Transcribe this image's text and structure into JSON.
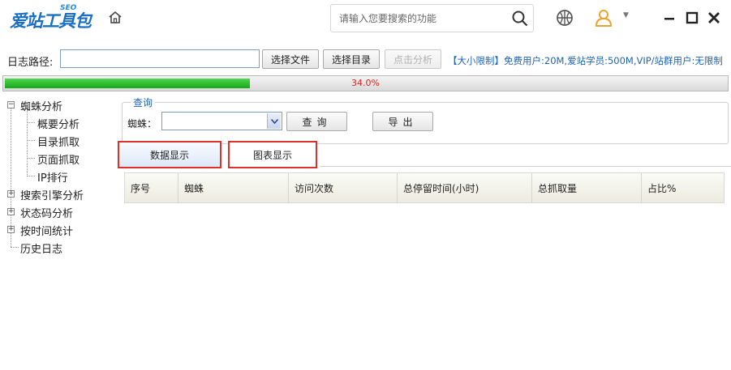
{
  "app": {
    "logo_text": "爱站工具包",
    "logo_badge": "SEO"
  },
  "search": {
    "placeholder": "请输入您要搜索的功能"
  },
  "toolbar": {
    "path_label": "日志路径:",
    "path_value": "",
    "choose_file": "选择文件",
    "choose_dir": "选择目录",
    "analyze": "点击分析",
    "size_note": "【大小限制】免费用户:20M,爱站学员:500M,VIP/站群用户:无限制"
  },
  "progress": {
    "value": 0.34,
    "label": "34.0%"
  },
  "sidebar": {
    "items": [
      {
        "label": "蜘蛛分析",
        "expandable": true,
        "expanded": true
      },
      {
        "label": "概要分析",
        "child": true
      },
      {
        "label": "目录抓取",
        "child": true
      },
      {
        "label": "页面抓取",
        "child": true
      },
      {
        "label": "IP排行",
        "child": true
      },
      {
        "label": "搜索引擎分析",
        "expandable": true,
        "expanded": false
      },
      {
        "label": "状态码分析",
        "expandable": true,
        "expanded": false
      },
      {
        "label": "按时间统计",
        "expandable": true,
        "expanded": false
      },
      {
        "label": "历史日志",
        "expandable": false
      }
    ]
  },
  "query": {
    "legend": "查询",
    "spider_label": "蜘蛛：",
    "spider_value": "",
    "query_button": "查询",
    "export_button": "导出"
  },
  "tabs": [
    {
      "label": "数据显示",
      "active": true
    },
    {
      "label": "图表显示",
      "active": false
    }
  ],
  "table": {
    "columns": [
      "序号",
      "蜘蛛",
      "访问次数",
      "总停留时间(小时)",
      "总抓取量",
      "占比%"
    ],
    "rows": []
  },
  "colors": {
    "accent": "#1e63b8",
    "highlight_border": "#e0302a",
    "progress_fill": "#19a619",
    "progress_text": "#d0281f"
  }
}
